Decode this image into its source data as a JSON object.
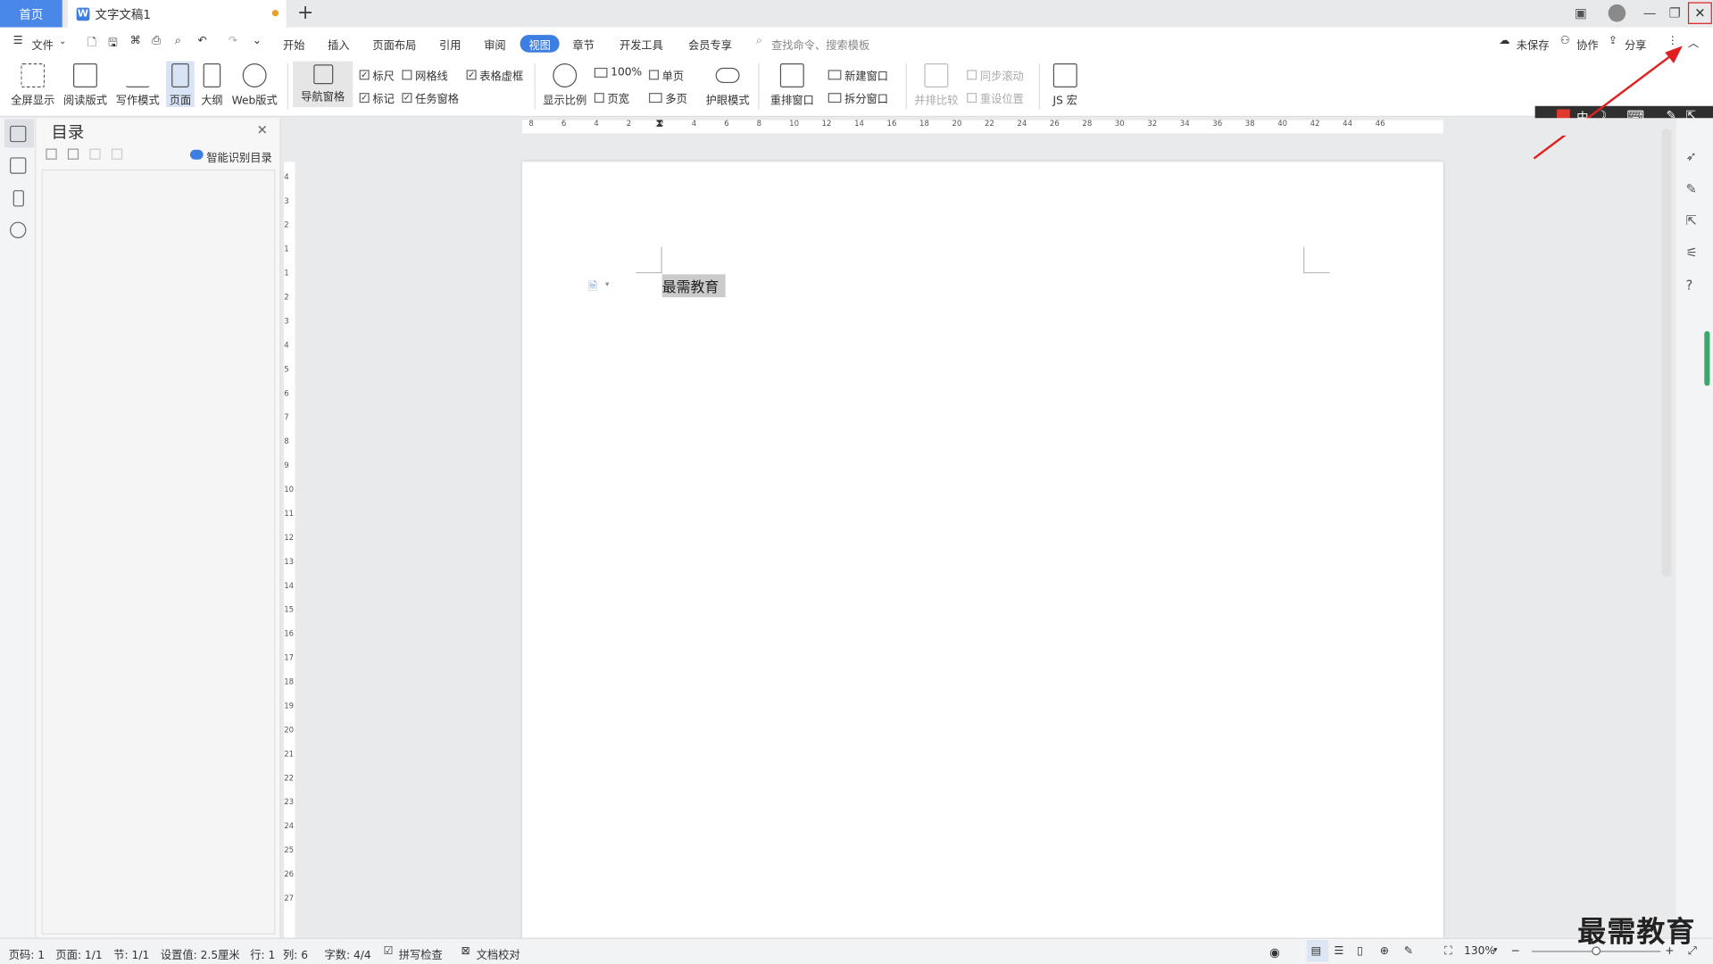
{
  "tabs": {
    "home": "首页",
    "document": "文字文稿1",
    "new_tab": "+"
  },
  "menu": {
    "file": "文件",
    "items": [
      "开始",
      "插入",
      "页面布局",
      "引用",
      "审阅",
      "视图",
      "章节",
      "开发工具",
      "会员专享"
    ],
    "search_placeholder": "查找命令、搜索模板",
    "unsaved": "未保存",
    "collab": "协作",
    "share": "分享"
  },
  "toolbar": {
    "big": [
      "全屏显示",
      "阅读版式",
      "写作模式",
      "页面",
      "大纲",
      "Web版式"
    ],
    "nav_pane": "导航窗格",
    "checks": [
      {
        "label": "标尺",
        "checked": true
      },
      {
        "label": "网格线",
        "checked": false
      },
      {
        "label": "表格虚框",
        "checked": true
      },
      {
        "label": "标记",
        "checked": true
      },
      {
        "label": "任务窗格",
        "checked": true
      }
    ],
    "zoom_label": "显示比例",
    "zoom_100": "100%",
    "page_width": "页宽",
    "single": "单页",
    "multi": "多页",
    "eye_mode": "护眼模式",
    "rearrange": "重排窗口",
    "new_window": "新建窗口",
    "split_window": "拆分窗口",
    "side_by_side": "并排比较",
    "sync_scroll": "同步滚动",
    "reset_pos": "重设位置",
    "macro": "JS 宏"
  },
  "toc": {
    "title": "目录",
    "smart": "智能识别目录"
  },
  "document": {
    "text": "最需教育"
  },
  "status": {
    "page_num": "页码: 1",
    "page": "页面: 1/1",
    "section": "节: 1/1",
    "setting": "设置值: 2.5厘米",
    "row": "行: 1",
    "col": "列: 6",
    "words": "字数: 4/4",
    "spell": "拼写检查",
    "proof": "文档校对",
    "zoom": "130%"
  },
  "watermark": "最需教育",
  "ruler_h": [
    "8",
    "6",
    "4",
    "2",
    "2",
    "4",
    "6",
    "8",
    "10",
    "12",
    "14",
    "16",
    "18",
    "20",
    "22",
    "24",
    "26",
    "28",
    "30",
    "32",
    "34",
    "36",
    "38",
    "40",
    "42",
    "44",
    "46"
  ],
  "ruler_v": [
    "4",
    "3",
    "2",
    "1",
    "1",
    "2",
    "3",
    "4",
    "5",
    "6",
    "7",
    "8",
    "9",
    "10",
    "11",
    "12",
    "13",
    "14",
    "15",
    "16",
    "17",
    "18",
    "19",
    "20",
    "21",
    "22",
    "23",
    "24",
    "25",
    "26",
    "27"
  ]
}
